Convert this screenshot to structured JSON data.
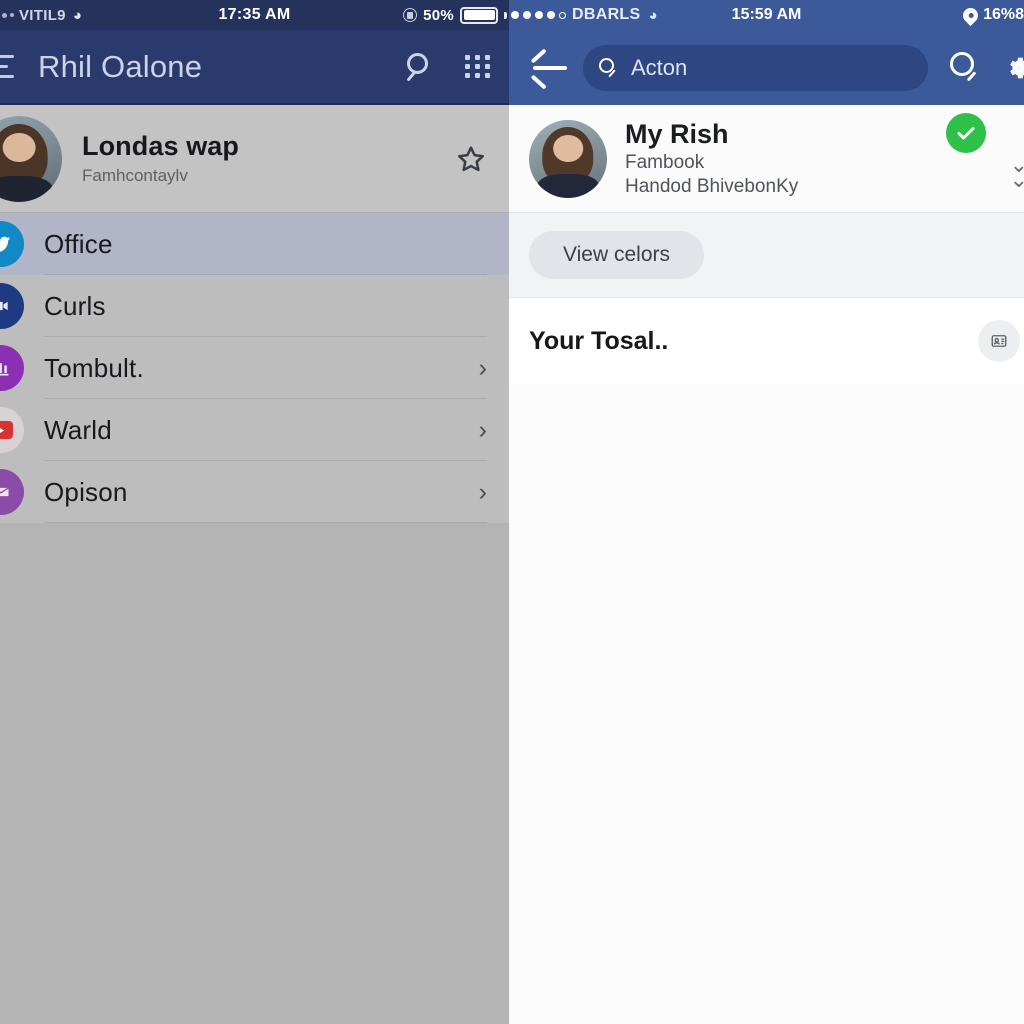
{
  "left_panel": {
    "status_bar": {
      "carrier": "VITIL9",
      "wifi_icon": "wifi-icon",
      "time": "17:35 AM",
      "lock_icon": "lock-icon",
      "battery_percent": "50%",
      "battery_icon": "battery-icon"
    },
    "app_bar": {
      "menu_icon": "hamburger-menu-icon",
      "title": "Rhil Oalone",
      "search_icon": "search-icon",
      "apps_grid_icon": "grid-apps-icon"
    },
    "profile": {
      "avatar_icon": "avatar",
      "name": "Londas wap",
      "subtitle": "Famhcontaylv",
      "star_icon": "star-outline-icon"
    },
    "list_items": [
      {
        "label": "Office",
        "icon": "bird-icon",
        "icon_color": "#1089c4",
        "active": true,
        "chevron": ""
      },
      {
        "label": "Curls",
        "icon": "video-icon",
        "icon_color": "#1d3a83",
        "active": false,
        "chevron": ""
      },
      {
        "label": "Tombult.",
        "icon": "chart-icon",
        "icon_color": "#8b2fb5",
        "active": false,
        "chevron": "›"
      },
      {
        "label": "Warld",
        "icon": "play-icon",
        "icon_color": "#d8d2d4",
        "active": false,
        "chevron": "›"
      },
      {
        "label": "Opison",
        "icon": "envelope-icon",
        "icon_color": "#8b4ba8",
        "active": false,
        "chevron": "›"
      }
    ]
  },
  "right_panel": {
    "status_bar": {
      "signal_icon": "signal-dots-icon",
      "carrier": "DBARLS",
      "wifi_icon": "wifi-icon",
      "time": "15:59 AM",
      "location_icon": "location-pin-icon",
      "battery_percent": "16%8"
    },
    "app_bar": {
      "back_icon": "back-arrow-icon",
      "search_icon": "search-icon",
      "search_value": "Acton",
      "search_placeholder": "Acton",
      "action_search_icon": "search-icon",
      "settings_icon": "gear-icon"
    },
    "profile": {
      "avatar_icon": "avatar",
      "name": "My Rish",
      "line1": "Fambook",
      "line2": "Handod BhivebonKy",
      "verified_icon": "check-badge-icon",
      "chevron_icon": "chevron-stack-icon"
    },
    "action_row": {
      "button_label": "View celors"
    },
    "section": {
      "title": "Your Tosal..",
      "icon": "contact-card-icon"
    }
  },
  "colors": {
    "left_status_bar": "#25325c",
    "left_app_bar": "#2b3a6c",
    "left_body": "#b4b4b4",
    "left_profile_bg": "#c3c3c3",
    "left_active_row": "#b2b4c7",
    "right_header": "#3c5a9a",
    "right_search_field": "#2e4681",
    "right_body": "#fcfcfd",
    "verified_green": "#2fc04a",
    "pill_button": "#e3e4ea"
  }
}
